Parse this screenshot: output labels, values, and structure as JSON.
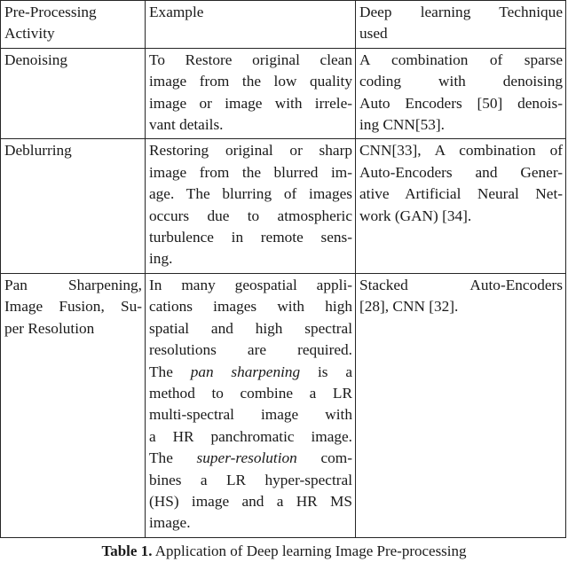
{
  "table": {
    "headers": [
      "Pre-Processing Activity",
      "Example",
      "Deep learning Technique used"
    ],
    "header_lines": {
      "col1": [
        "Pre-Processing",
        "Activity"
      ],
      "col2": [
        "Example"
      ],
      "col3": [
        "Deep learning Technique",
        "used"
      ]
    },
    "rows": [
      {
        "activity": "Denoising",
        "activity_lines": [
          "Denoising"
        ],
        "example": "To Restore original clean image from the low quality image or image with irrelevant details.",
        "example_lines": [
          "To Restore original clean",
          "image from the low quality",
          "image or image with irrele-",
          "vant details."
        ],
        "technique": "A combination of sparse coding with denoising Auto Encoders [50] denoising CNN[53].",
        "technique_lines": [
          "A combination of sparse",
          "coding with denoising",
          "Auto Encoders [50] denois-",
          "ing CNN[53]."
        ]
      },
      {
        "activity": "Deblurring",
        "activity_lines": [
          "Deblurring"
        ],
        "example": "Restoring original or sharp image from the blurred image. The blurring of images occurs due to atmospheric turbulence in remote sensing.",
        "example_lines": [
          "Restoring original or sharp",
          "image from the blurred im-",
          "age. The blurring of images",
          "occurs due to atmospheric",
          "turbulence in remote sens-",
          "ing."
        ],
        "technique": "CNN[33], A combination of Auto-Encoders and Generative Artificial Neural Network (GAN) [34].",
        "technique_lines": [
          "CNN[33], A combination of",
          "Auto-Encoders and Gener-",
          "ative Artificial Neural Net-",
          "work (GAN) [34]."
        ]
      },
      {
        "activity": "Pan Sharpening, Image Fusion, Super Resolution",
        "activity_lines": [
          "Pan Sharpening,",
          "Image Fusion, Su-",
          "per Resolution"
        ],
        "example": "In many geospatial applications images with high spatial and high spectral resolutions are required. The pan sharpening is a method to combine a LR multi-spectral image with a HR panchromatic image. The super-resolution combines a LR hyper-spectral (HS) image and a HR MS image.",
        "example_lines_parts": [
          [
            {
              "t": "In many geospatial appli-",
              "i": false
            }
          ],
          [
            {
              "t": "cations images with high",
              "i": false
            }
          ],
          [
            {
              "t": "spatial and high spectral",
              "i": false
            }
          ],
          [
            {
              "t": "resolutions are required.",
              "i": false
            }
          ],
          [
            {
              "t": "The ",
              "i": false
            },
            {
              "t": "pan sharpening",
              "i": true
            },
            {
              "t": " is a",
              "i": false
            }
          ],
          [
            {
              "t": "method to combine a LR",
              "i": false
            }
          ],
          [
            {
              "t": "multi-spectral image with",
              "i": false
            }
          ],
          [
            {
              "t": "a HR panchromatic image.",
              "i": false
            }
          ],
          [
            {
              "t": "The ",
              "i": false
            },
            {
              "t": "super-resolution",
              "i": true
            },
            {
              "t": " com-",
              "i": false
            }
          ],
          [
            {
              "t": "bines a LR hyper-spectral",
              "i": false
            }
          ],
          [
            {
              "t": "(HS) image and a HR MS",
              "i": false
            }
          ],
          [
            {
              "t": "image.",
              "i": false
            }
          ]
        ],
        "technique": "Stacked Auto-Encoders [28], CNN [32].",
        "technique_lines": [
          "Stacked Auto-Encoders",
          "[28], CNN [32]."
        ]
      }
    ]
  },
  "caption": {
    "label": "Table 1.",
    "text": " Application of Deep learning Image Pre-processing"
  },
  "colors": {
    "border": "#262626",
    "text": "#1a1a1a",
    "background": "#ffffff"
  }
}
